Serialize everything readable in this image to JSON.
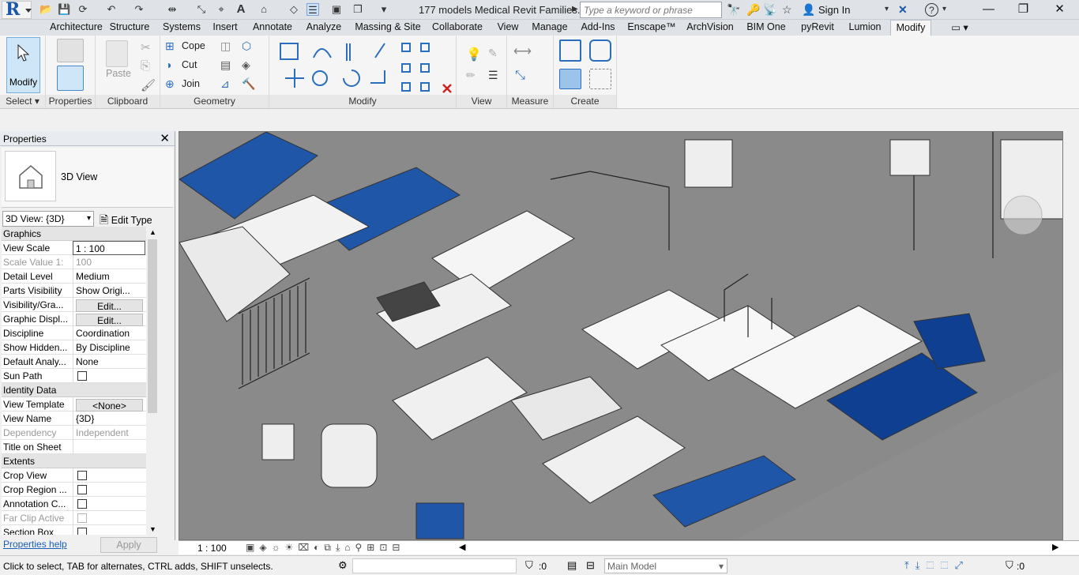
{
  "app": {
    "logo_letter": "R",
    "document_title": "177 models Medical Revit Families...",
    "search_placeholder": "Type a keyword or phrase",
    "sign_in": "Sign In"
  },
  "tabs": [
    "Architecture",
    "Structure",
    "Systems",
    "Insert",
    "Annotate",
    "Analyze",
    "Massing & Site",
    "Collaborate",
    "View",
    "Manage",
    "Add-Ins",
    "Enscape™",
    "ArchVision",
    "BIM One",
    "pyRevit",
    "Lumion",
    "Modify"
  ],
  "active_tab": "Modify",
  "ribbon": {
    "modify_label": "Modify",
    "panels": {
      "select": "Select ▾",
      "properties": "Properties",
      "clipboard": "Clipboard",
      "geometry": "Geometry",
      "modify": "Modify",
      "view": "View",
      "measure": "Measure",
      "create": "Create"
    },
    "clipboard": {
      "paste": "Paste"
    },
    "geometry": {
      "cope": "Cope",
      "cut": "Cut",
      "join": "Join"
    }
  },
  "properties": {
    "title": "Properties",
    "type_name": "3D View",
    "view_selector": "3D View: {3D}",
    "edit_type": "Edit Type",
    "groups": [
      {
        "name": "Graphics",
        "rows": [
          {
            "k": "View Scale",
            "v": "1 : 100"
          },
          {
            "k": "Scale Value    1:",
            "v": "100",
            "dis": true
          },
          {
            "k": "Detail Level",
            "v": "Medium"
          },
          {
            "k": "Parts Visibility",
            "v": "Show Origi..."
          },
          {
            "k": "Visibility/Gra...",
            "v": "Edit...",
            "btn": true
          },
          {
            "k": "Graphic Displ...",
            "v": "Edit...",
            "btn": true
          },
          {
            "k": "Discipline",
            "v": "Coordination"
          },
          {
            "k": "Show Hidden...",
            "v": "By Discipline"
          },
          {
            "k": "Default Analy...",
            "v": "None"
          },
          {
            "k": "Sun Path",
            "v": "",
            "cb": true
          }
        ]
      },
      {
        "name": "Identity Data",
        "rows": [
          {
            "k": "View Template",
            "v": "<None>",
            "btn": true
          },
          {
            "k": "View Name",
            "v": "{3D}"
          },
          {
            "k": "Dependency",
            "v": "Independent",
            "dis": true
          },
          {
            "k": "Title on Sheet",
            "v": ""
          }
        ]
      },
      {
        "name": "Extents",
        "rows": [
          {
            "k": "Crop View",
            "v": "",
            "cb": true
          },
          {
            "k": "Crop Region ...",
            "v": "",
            "cb": true
          },
          {
            "k": "Annotation C...",
            "v": "",
            "cb": true
          },
          {
            "k": "Far Clip Active",
            "v": "",
            "cb": true,
            "dis": true
          },
          {
            "k": "Section Box",
            "v": "",
            "cb": true
          }
        ]
      }
    ],
    "help": "Properties help",
    "apply": "Apply"
  },
  "viewport": {
    "scale": "1 : 100"
  },
  "status": {
    "text": "Click to select, TAB for alternates, CTRL adds, SHIFT unselects.",
    "filter_count": ":0",
    "model": "Main Model",
    "select_count": ":0"
  }
}
